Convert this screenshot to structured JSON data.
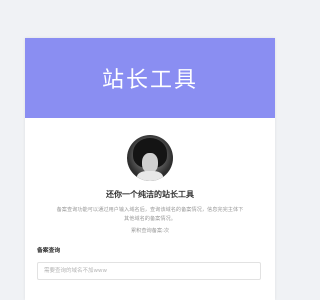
{
  "header": {
    "title": "站长工具",
    "background_color": "#8a8ef2"
  },
  "profile": {
    "avatar_icon": "avatar-photo-icon",
    "subtitle": "还你一个纯洁的站长工具",
    "description": "备案查询功能可以通过用户输入域名后，查询该域名的备案情况，信息完完主体下其他域名的备案情况。",
    "count_text": "累积查询备案:次"
  },
  "search": {
    "label": "备案查询",
    "placeholder": "需要查询的域名不加www",
    "value": ""
  }
}
